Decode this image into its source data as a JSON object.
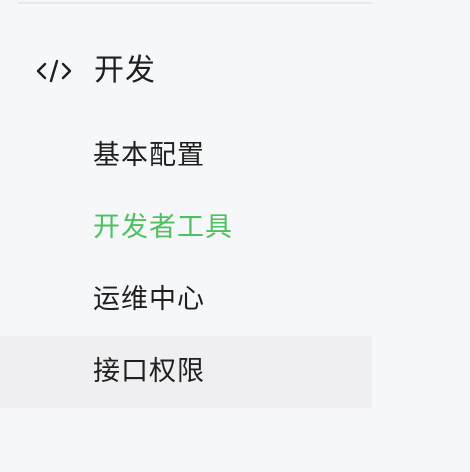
{
  "sidebar": {
    "section": {
      "title": "开发",
      "icon": "code-icon"
    },
    "items": [
      {
        "label": "基本配置",
        "state": "default"
      },
      {
        "label": "开发者工具",
        "state": "active"
      },
      {
        "label": "运维中心",
        "state": "default"
      },
      {
        "label": "接口权限",
        "state": "hover"
      }
    ]
  },
  "colors": {
    "active_text": "#4fc061",
    "default_text": "#1f1f1f",
    "background": "#f6f7f9",
    "hover_background": "#efeff1"
  }
}
